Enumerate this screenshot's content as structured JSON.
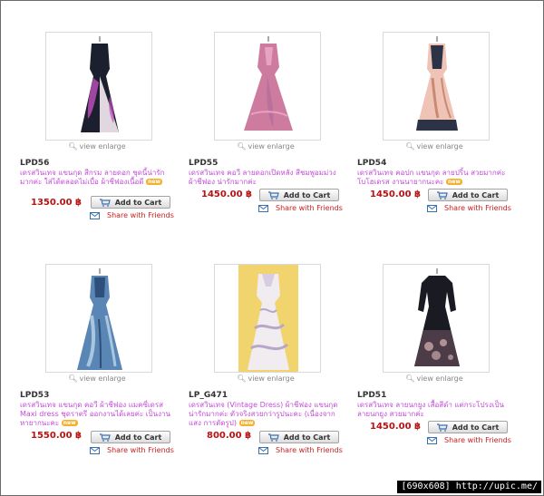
{
  "view_enlarge_label": "view enlarge",
  "add_to_cart_label": "Add to Cart",
  "share_label": "Share with Friends",
  "new_badge": "new",
  "products": [
    {
      "code": "LPD56",
      "title": "เดรสวินเทจ แขนกุด สีกรม ลายดอก ชุดนี้น่ารักมากค่ะ ใส่ได้ตลอดไม่เบื่อ ผ้าชีฟองเนื้อดี",
      "price": "1350.00 ฿",
      "dress_colors": [
        "#1b1f2e",
        "#e0d7df",
        "#c24fbf"
      ]
    },
    {
      "code": "LPD55",
      "title": "เดรสวินเทจ คอวี ลายดอกเปิดหลัง สีชมพูอมม่วง ผ้าชีฟอง น่ารักมากค่ะ",
      "price": "1450.00 ฿",
      "dress_colors": [
        "#cd7c9f",
        "#e7a3bf",
        "#b46d9b"
      ]
    },
    {
      "code": "LPD54",
      "title": "เดรสวินเทจ คอปก แขนกุด ลายปริ้น สวยมากค่ะ โบโฮเดรส งานนายากนะคะ",
      "price": "1450.00 ฿",
      "dress_colors": [
        "#efc4b6",
        "#2c3346",
        "#c98a72"
      ]
    },
    {
      "code": "LPD53",
      "title": "เดรสวินเทจ แขนกุด คอวี ผ้าชีฟอง แมคซี่เดรส Maxi dress ชุดราตรี ออกงานได้เลยค่ะ เป็นงานหายากนะคะ",
      "price": "1550.00 ฿",
      "dress_colors": [
        "#5a86b6",
        "#a9c6df",
        "#2e4f7a"
      ]
    },
    {
      "code": "LP_G471",
      "title": "เดรสวินเทจ (Vintage Dress) ผ้าชีฟอง แขนกุด น่ารักมากค่ะ ตัวจริงสวยกว่ารูปนะคะ (เนื่องจากแสง การตัดรูป)",
      "price": "800.00 ฿",
      "dress_colors": [
        "#f0ecef",
        "#b6a7c9",
        "#f2d46e"
      ]
    },
    {
      "code": "LPD51",
      "title": "เดรสวินเทจ ลายนกยูง เสื้อสีดำ แต่กระโปรงเป็นลายนกยูง สวยมากค่ะ",
      "price": "1450.00 ฿",
      "dress_colors": [
        "#1a1a22",
        "#c9a7a8",
        "#4b3c48"
      ]
    }
  ],
  "watermark": "[690x608] http://upic.me/"
}
